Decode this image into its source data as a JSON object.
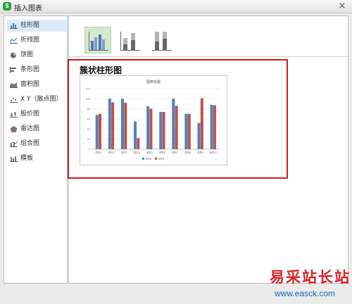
{
  "window": {
    "title": "插入图表",
    "app_icon_letter": "S"
  },
  "sidebar": {
    "items": [
      {
        "label": "柱形图",
        "icon": "column-chart-icon",
        "active": true
      },
      {
        "label": "折线图",
        "icon": "line-chart-icon"
      },
      {
        "label": "饼图",
        "icon": "pie-chart-icon"
      },
      {
        "label": "条形图",
        "icon": "bar-chart-icon"
      },
      {
        "label": "面积图",
        "icon": "area-chart-icon"
      },
      {
        "label": "X Y（散点图）",
        "icon": "scatter-chart-icon"
      },
      {
        "label": "股价图",
        "icon": "stock-chart-icon"
      },
      {
        "label": "雷达图",
        "icon": "radar-chart-icon"
      },
      {
        "label": "组合图",
        "icon": "combo-chart-icon"
      },
      {
        "label": "模板",
        "icon": "template-icon"
      }
    ]
  },
  "subtypes": [
    {
      "name": "clustered-column",
      "active": true
    },
    {
      "name": "stacked-column"
    },
    {
      "name": "percent-stacked-column"
    }
  ],
  "preview": {
    "title": "簇状柱形图"
  },
  "chart_data": {
    "type": "bar",
    "title": "图表标题",
    "categories": [
      "类别1",
      "类别2",
      "类别3",
      "类别4",
      "类别5",
      "类别6",
      "类别7",
      "类别8",
      "类别9",
      "类别10"
    ],
    "series": [
      {
        "name": "系列1",
        "values": [
          68,
          100,
          100,
          55,
          85,
          74,
          100,
          70,
          52,
          88
        ],
        "color": "#4f81bd"
      },
      {
        "name": "系列2",
        "values": [
          70,
          93,
          92,
          22,
          80,
          74,
          86,
          70,
          101,
          87
        ],
        "color": "#c0504d"
      }
    ],
    "ylim": [
      0,
      120
    ],
    "yticks": [
      0,
      20,
      40,
      60,
      80,
      100,
      120
    ],
    "grid": true,
    "legend": "bottom"
  },
  "watermark": {
    "text": "易采站长站",
    "url": "www.easck.com"
  }
}
